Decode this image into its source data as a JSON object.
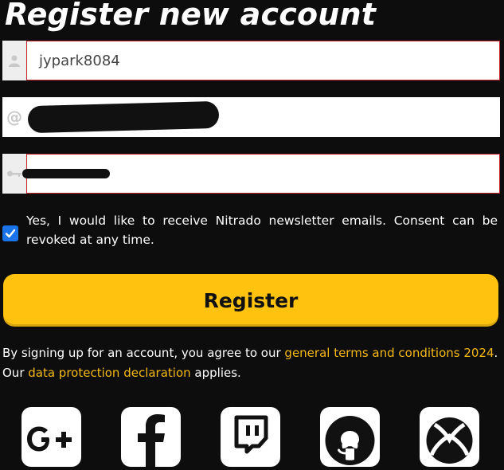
{
  "title": "Register new account",
  "form": {
    "username_value": "jypark8084",
    "email_value": "",
    "password_value": "",
    "icons": {
      "username": "user-icon",
      "email": "at-icon",
      "password": "key-icon"
    }
  },
  "consent": {
    "checked": true,
    "text": "Yes, I would like to receive Nitrado newsletter emails. Consent can be revoked at any time."
  },
  "register_button": {
    "label": "Register",
    "color": "#ffc30f"
  },
  "terms": {
    "before": "By signing up for an account, you agree to our ",
    "terms_link": "general terms and conditions 2024",
    "middle": ". Our ",
    "privacy_link": "data protection declaration",
    "after": " applies.",
    "link_color": "#f5b815"
  },
  "social_logins": [
    {
      "name": "google-plus",
      "icon": "google-plus-icon"
    },
    {
      "name": "facebook",
      "icon": "facebook-icon"
    },
    {
      "name": "twitch",
      "icon": "twitch-icon"
    },
    {
      "name": "github",
      "icon": "github-icon"
    },
    {
      "name": "xbox",
      "icon": "xbox-icon"
    }
  ]
}
